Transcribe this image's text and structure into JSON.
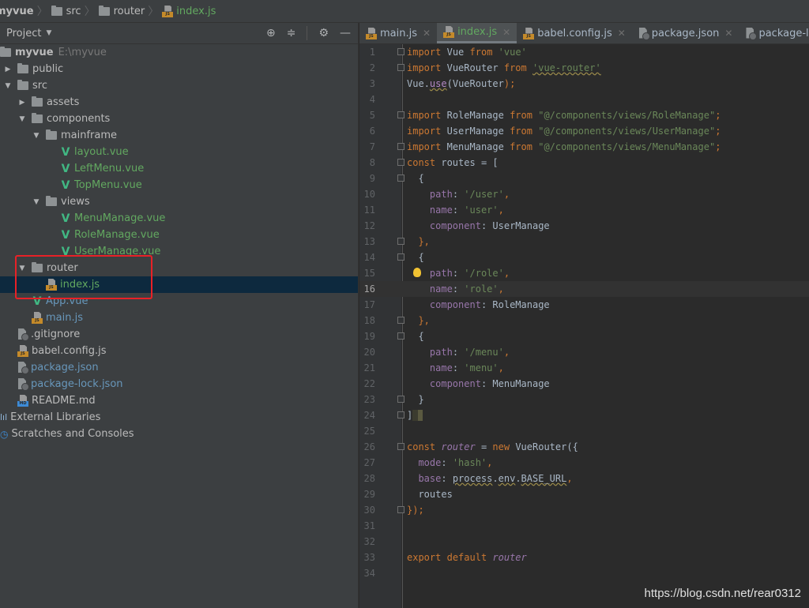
{
  "breadcrumb": [
    {
      "label": "myvue",
      "icon": "none"
    },
    {
      "label": "src",
      "icon": "folder-icon"
    },
    {
      "label": "router",
      "icon": "folder-icon"
    },
    {
      "label": "index.js",
      "icon": "js-file-icon"
    }
  ],
  "project_panel": {
    "title": "Project",
    "tools": [
      "locate-icon",
      "collapse-all-icon",
      "gear-icon",
      "minimize-icon"
    ]
  },
  "tree": [
    {
      "label": "myvue",
      "hint": "E:\\myvue",
      "depth": 0,
      "type": "folder",
      "arrow": "none",
      "color": "bold"
    },
    {
      "label": "public",
      "depth": 0,
      "type": "folder",
      "arrow": "right"
    },
    {
      "label": "src",
      "depth": 0,
      "type": "folder",
      "arrow": "down"
    },
    {
      "label": "assets",
      "depth": 1,
      "type": "folder",
      "arrow": "right"
    },
    {
      "label": "components",
      "depth": 1,
      "type": "folder",
      "arrow": "down"
    },
    {
      "label": "mainframe",
      "depth": 2,
      "type": "folder",
      "arrow": "down"
    },
    {
      "label": "layout.vue",
      "depth": 3,
      "type": "vue",
      "color": "green"
    },
    {
      "label": "LeftMenu.vue",
      "depth": 3,
      "type": "vue",
      "color": "green"
    },
    {
      "label": "TopMenu.vue",
      "depth": 3,
      "type": "vue",
      "color": "green"
    },
    {
      "label": "views",
      "depth": 2,
      "type": "folder",
      "arrow": "down"
    },
    {
      "label": "MenuManage.vue",
      "depth": 3,
      "type": "vue",
      "color": "green"
    },
    {
      "label": "RoleManage.vue",
      "depth": 3,
      "type": "vue",
      "color": "green"
    },
    {
      "label": "UserManage.vue",
      "depth": 3,
      "type": "vue",
      "color": "green"
    },
    {
      "label": "router",
      "depth": 1,
      "type": "folder",
      "arrow": "down"
    },
    {
      "label": "index.js",
      "depth": 2,
      "type": "js",
      "color": "green",
      "selected": true
    },
    {
      "label": "App.vue",
      "depth": 1,
      "type": "vue",
      "color": "blue"
    },
    {
      "label": "main.js",
      "depth": 1,
      "type": "js",
      "color": "blue"
    },
    {
      "label": ".gitignore",
      "depth": 0,
      "type": "ignore"
    },
    {
      "label": "babel.config.js",
      "depth": 0,
      "type": "js"
    },
    {
      "label": "package.json",
      "depth": 0,
      "type": "json",
      "color": "blue"
    },
    {
      "label": "package-lock.json",
      "depth": 0,
      "type": "json",
      "color": "blue"
    },
    {
      "label": "README.md",
      "depth": 0,
      "type": "md"
    },
    {
      "label": "External Libraries",
      "depth": -1,
      "type": "libs"
    },
    {
      "label": "Scratches and Consoles",
      "depth": -1,
      "type": "scratch"
    }
  ],
  "tabs": [
    {
      "label": "main.js",
      "icon": "js-file-icon",
      "active": false
    },
    {
      "label": "index.js",
      "icon": "js-file-icon",
      "active": true
    },
    {
      "label": "babel.config.js",
      "icon": "js-file-icon",
      "active": false
    },
    {
      "label": "package.json",
      "icon": "json-file-icon",
      "active": false
    },
    {
      "label": "package-lock.json",
      "icon": "json-file-icon",
      "active": false
    }
  ],
  "editor": {
    "current_line": 16,
    "lines": [
      "import Vue from 'vue'",
      "import VueRouter from 'vue-router'",
      "Vue.use(VueRouter);",
      "",
      "import RoleManage from \"@/components/views/RoleManage\";",
      "import UserManage from \"@/components/views/UserManage\";",
      "import MenuManage from \"@/components/views/MenuManage\";",
      "const routes = [",
      "  {",
      "    path: '/user',",
      "    name: 'user',",
      "    component: UserManage",
      "  },",
      "  {",
      "    path: '/role',",
      "    name: 'role',",
      "    component: RoleManage",
      "  },",
      "  {",
      "    path: '/menu',",
      "    name: 'menu',",
      "    component: MenuManage",
      "  }",
      "]",
      "",
      "const router = new VueRouter({",
      "  mode: 'hash',",
      "  base: process.env.BASE_URL,",
      "  routes",
      "});",
      "",
      "",
      "export default router",
      ""
    ]
  },
  "watermark": "https://blog.csdn.net/rear0312"
}
